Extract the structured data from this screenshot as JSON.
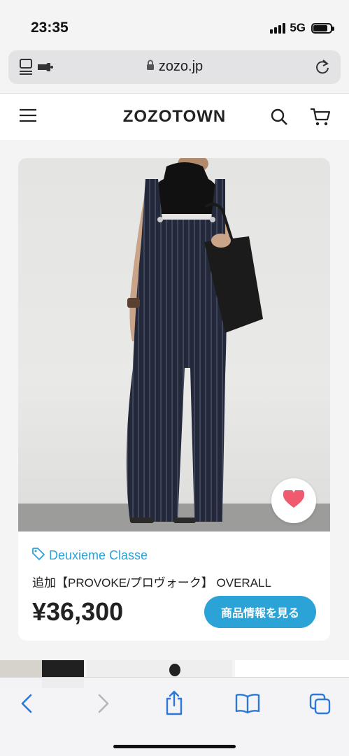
{
  "status_bar": {
    "time": "23:35",
    "network": "5G",
    "battery_level": 0.85
  },
  "browser": {
    "url": "zozo.jp"
  },
  "site": {
    "logo": "ZOZOTOWN"
  },
  "product": {
    "brand": "Deuxieme Classe",
    "title": "追加【PROVOKE/プロヴォーク】 OVERALL",
    "price": "¥36,300",
    "cta_label": "商品情報を見る"
  },
  "colors": {
    "accent": "#2ba3d6",
    "heart": "#ef5a6f"
  },
  "icons": [
    "menu-icon",
    "search-icon",
    "cart-icon",
    "heart-icon",
    "tag-icon",
    "lock-icon",
    "reload-icon",
    "back-icon",
    "forward-icon",
    "share-icon",
    "bookmarks-icon",
    "tabs-icon"
  ]
}
